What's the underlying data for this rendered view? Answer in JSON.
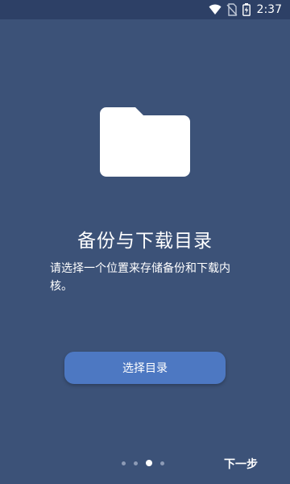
{
  "status_bar": {
    "time": "2:37",
    "icons": [
      "wifi-icon",
      "no-sim-icon",
      "battery-charging-icon"
    ]
  },
  "onboarding": {
    "illustration_icon": "folder-icon",
    "title": "备份与下载目录",
    "description": "请选择一个位置来存储备份和下载内核。",
    "select_button_label": "选择目录",
    "next_label": "下一步",
    "page_indicator": {
      "total": 4,
      "current": 3
    }
  },
  "colors": {
    "background": "#3c5278",
    "status_bar": "#2d4066",
    "button": "#4d78c2",
    "dot_inactive": "#8d9bb6",
    "dot_active": "#ffffff"
  }
}
